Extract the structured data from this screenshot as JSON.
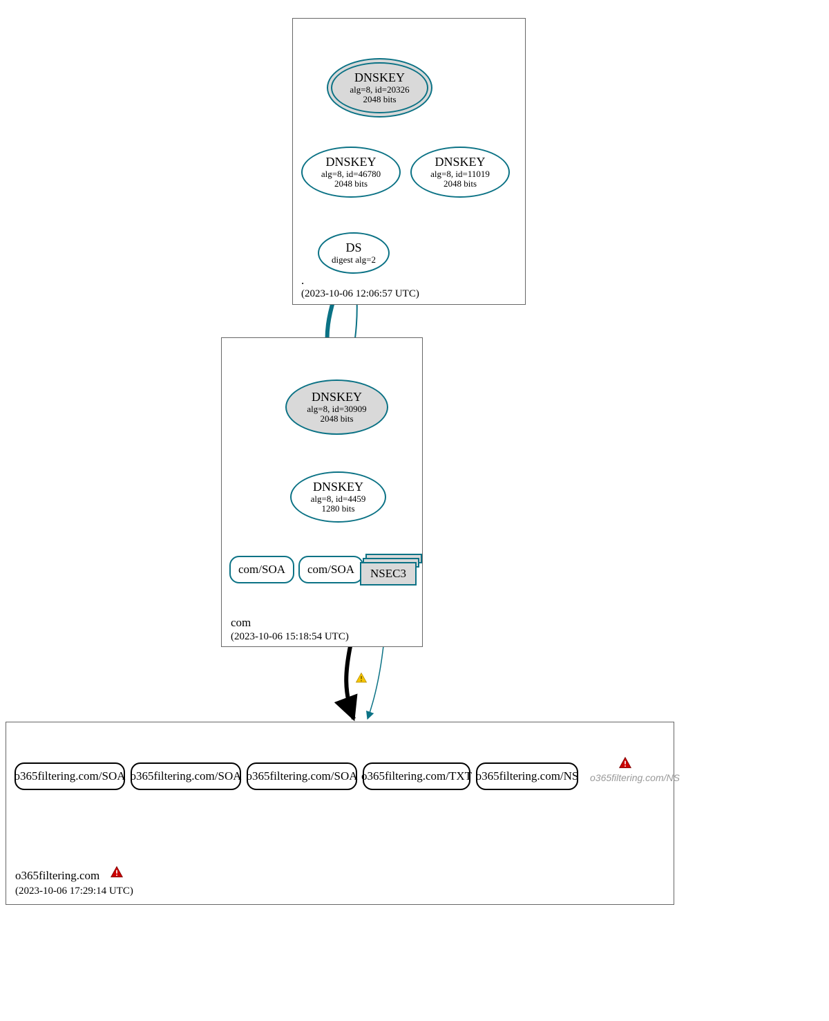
{
  "zones": {
    "root": {
      "label": ".",
      "timestamp": "(2023-10-06 12:06:57 UTC)"
    },
    "com": {
      "label": "com",
      "timestamp": "(2023-10-06 15:18:54 UTC)"
    },
    "leaf": {
      "label": "o365filtering.com",
      "timestamp": "(2023-10-06 17:29:14 UTC)"
    }
  },
  "nodes": {
    "root_ksk": {
      "title": "DNSKEY",
      "line2": "alg=8, id=20326",
      "line3": "2048 bits"
    },
    "root_zsk1": {
      "title": "DNSKEY",
      "line2": "alg=8, id=46780",
      "line3": "2048 bits"
    },
    "root_zsk2": {
      "title": "DNSKEY",
      "line2": "alg=8, id=11019",
      "line3": "2048 bits"
    },
    "root_ds": {
      "title": "DS",
      "line2": "digest alg=2"
    },
    "com_ksk": {
      "title": "DNSKEY",
      "line2": "alg=8, id=30909",
      "line3": "2048 bits"
    },
    "com_zsk": {
      "title": "DNSKEY",
      "line2": "alg=8, id=4459",
      "line3": "1280 bits"
    },
    "com_soa1": "com/SOA",
    "com_soa2": "com/SOA",
    "nsec3": "NSEC3",
    "leaf_soa1": "o365filtering.com/SOA",
    "leaf_soa2": "o365filtering.com/SOA",
    "leaf_soa3": "o365filtering.com/SOA",
    "leaf_txt": "o365filtering.com/TXT",
    "leaf_ns": "o365filtering.com/NS",
    "leaf_ns_faded": "o365filtering.com/NS"
  }
}
